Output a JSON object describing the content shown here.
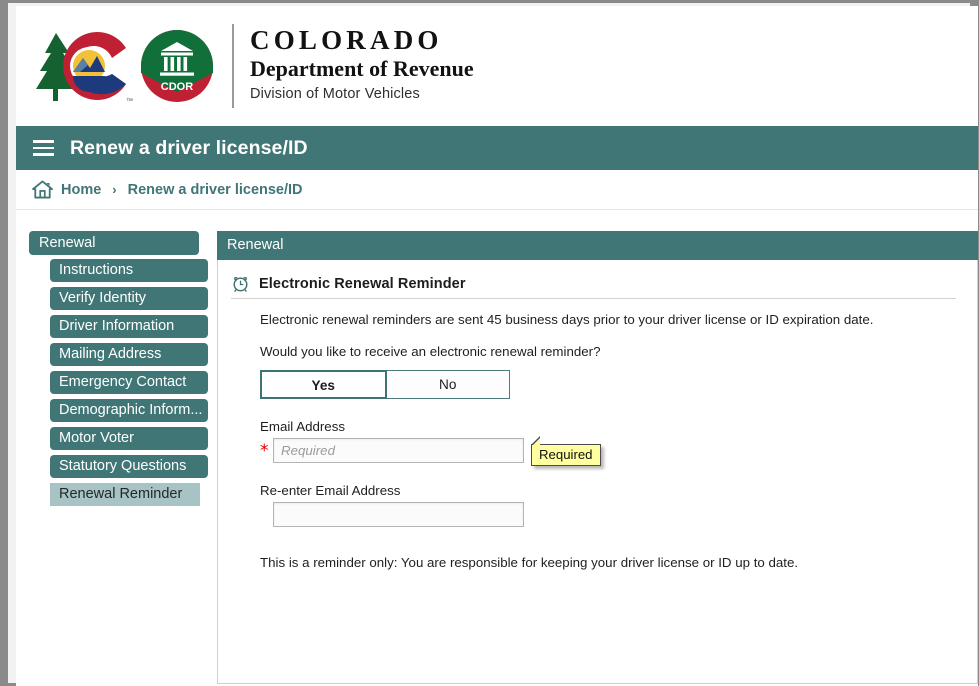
{
  "brand": {
    "state": "COLORADO",
    "department": "Department of Revenue",
    "division": "Division of Motor Vehicles",
    "cdor_label": "CDOR",
    "colors": {
      "teal": "#417677",
      "red": "#bf2033",
      "green": "#11703a",
      "blue": "#1d3a7d",
      "gold": "#f2c13a"
    }
  },
  "titlebar": {
    "menu_icon": "hamburger-menu-icon",
    "title": "Renew a driver license/ID"
  },
  "breadcrumb": {
    "home_icon": "home-icon",
    "home_label": "Home",
    "separator": "›",
    "current": "Renew a driver license/ID"
  },
  "sidebar": {
    "root_label": "Renewal",
    "items": [
      {
        "label": "Instructions",
        "active": false
      },
      {
        "label": "Verify Identity",
        "active": false
      },
      {
        "label": "Driver Information",
        "active": false
      },
      {
        "label": "Mailing Address",
        "active": false
      },
      {
        "label": "Emergency Contact",
        "active": false
      },
      {
        "label": "Demographic Inform...",
        "active": false
      },
      {
        "label": "Motor Voter",
        "active": false
      },
      {
        "label": "Statutory Questions",
        "active": false
      },
      {
        "label": "Renewal Reminder",
        "active": true
      }
    ]
  },
  "main": {
    "panel_header": "Renewal",
    "section": {
      "icon": "alarm-clock-icon",
      "title": "Electronic Renewal Reminder",
      "intro": "Electronic renewal reminders are sent 45 business days prior to your driver license or ID expiration date.",
      "question": "Would you like to receive an electronic renewal reminder?",
      "choices": [
        {
          "label": "Yes",
          "selected": true
        },
        {
          "label": "No",
          "selected": false
        }
      ],
      "email": {
        "label": "Email Address",
        "required_marker": "*",
        "value": "",
        "placeholder": "Required",
        "tooltip": "Required"
      },
      "reenter_email": {
        "label": "Re-enter Email Address",
        "value": "",
        "placeholder": ""
      },
      "footnote": "This is a reminder only: You are responsible for keeping your driver license or ID up to date."
    }
  }
}
